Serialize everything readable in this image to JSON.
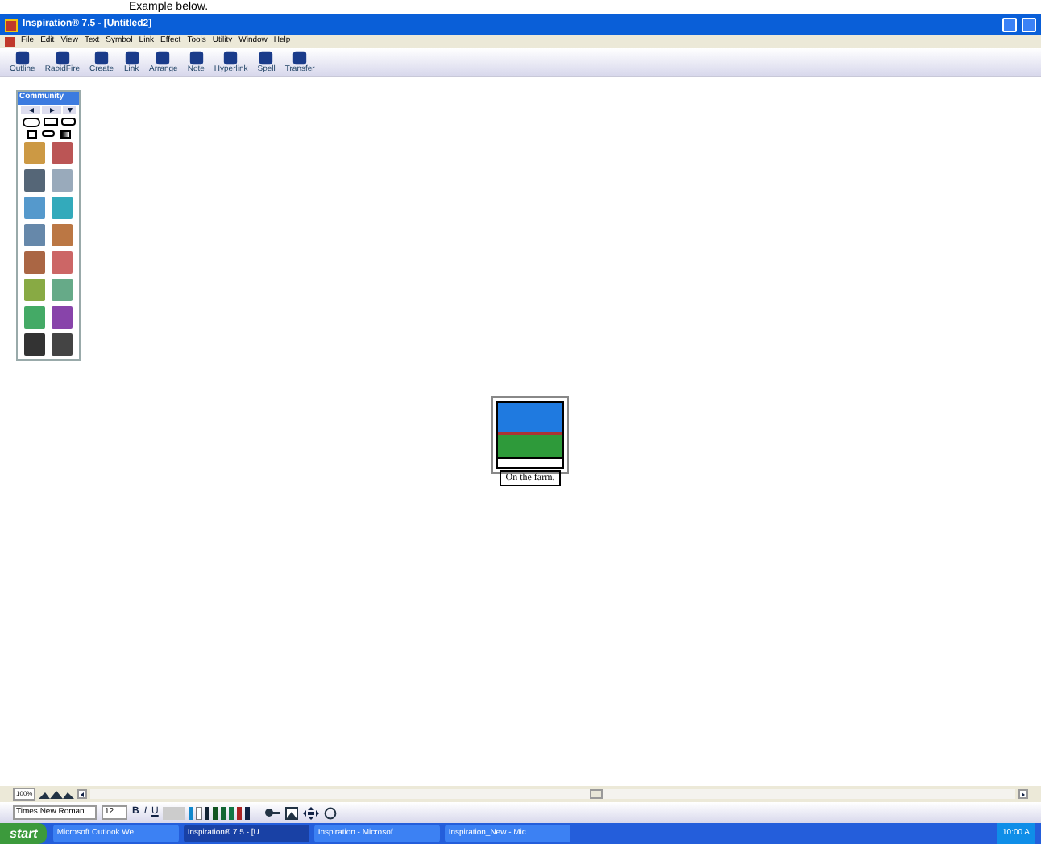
{
  "document_caption": "Example below.",
  "window": {
    "title": "Inspiration® 7.5 - [Untitled2]"
  },
  "menu": [
    "File",
    "Edit",
    "View",
    "Text",
    "Symbol",
    "Link",
    "Effect",
    "Tools",
    "Utility",
    "Window",
    "Help"
  ],
  "toolbar": [
    "Outline",
    "RapidFire",
    "Create",
    "Link",
    "Arrange",
    "Note",
    "Hyperlink",
    "Spell",
    "Transfer"
  ],
  "palette": {
    "title": "Community"
  },
  "symbol": {
    "caption": "On the farm.",
    "selected": true
  },
  "zoom": "100%",
  "format_bar": {
    "font": "Times New Roman",
    "size": "12",
    "buttons": [
      "B",
      "I",
      "U"
    ]
  },
  "taskbar": {
    "start": "start",
    "tasks": [
      {
        "label": "Microsoft Outlook We...",
        "selected": false
      },
      {
        "label": "Inspiration® 7.5 - [U...",
        "selected": true
      },
      {
        "label": "Inspiration - Microsof...",
        "selected": false
      },
      {
        "label": "Inspiration_New - Mic...",
        "selected": false
      }
    ],
    "clock": "10:00 A"
  }
}
